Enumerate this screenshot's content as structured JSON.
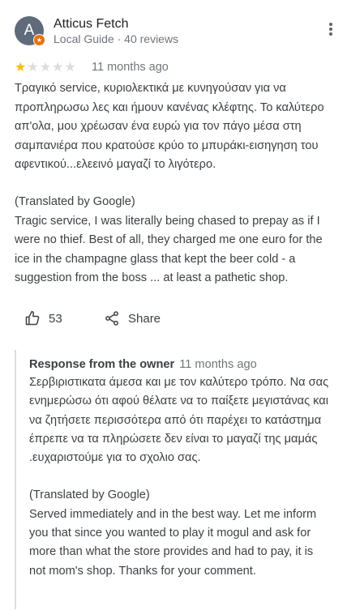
{
  "reviewer": {
    "initial": "A",
    "name": "Atticus Fetch",
    "meta": "Local Guide · 40 reviews",
    "badge_icon": "local-guide-star-icon"
  },
  "review": {
    "stars_filled": 1,
    "stars_total": 5,
    "star_on": "★",
    "star_off": "★★★★",
    "time": "11 months ago",
    "original_text": "Τραγικό service, κυριολεκτικά με κυνηγούσαν για να προπληρωσω λες και ήμουν κανένας κλέφτης. Το καλύτερο απ'ολα, μου χρέωσαν ένα ευρώ για τον πάγο μέσα στη σαμπανιέρα που κρατούσε κρύο το μπυράκι-εισηγηση του αφεντικού...ελεεινό μαγαζί το λιγότερο.",
    "translated_label": "(Translated by Google)",
    "translated_text": "Tragic service, I was literally being chased to prepay as if I were no thief. Best of all, they charged me one euro for the ice in the champagne glass that kept the beer cold - a suggestion from the boss ... at least a pathetic shop."
  },
  "actions": {
    "like_count": "53",
    "share_label": "Share"
  },
  "owner_response": {
    "title": "Response from the owner",
    "time": "11 months ago",
    "original_text": "Σερβιριστικατα άμεσα και με τον καλύτερο τρόπο. Να σας ενημερώσω  ότι αφού θέλατε να το παίξετε μεγιστάνας  και να ζητήσετε περισσότερα  από ότι παρέχει το κατάστημα έπρεπε να τα πληρώσετε δεν είναι το μαγαζί της μαμάς .ευχαριστούμε  για το σχολιο σας.",
    "translated_label": "(Translated by Google)",
    "translated_text": "Served immediately and in the best way. Let me inform you that since you wanted to play it mogul and ask for more than what the store provides and had to pay, it is not mom's shop. Thanks for your comment."
  },
  "colors": {
    "star": "#fbbc04",
    "star_empty": "#dadce0",
    "avatar_bg": "#5f6b7a",
    "badge": "#e8710a",
    "secondary_text": "#70757a"
  }
}
